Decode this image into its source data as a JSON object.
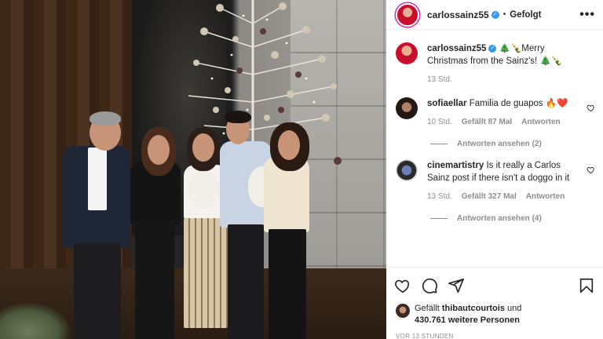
{
  "post": {
    "username": "carlossainz55",
    "follow_status": "Gefolgt",
    "more_label": "•••"
  },
  "caption": {
    "username": "carlossainz55",
    "emojis_before": "🎄🍾",
    "text": "Merry Christmas from the Sainz's!",
    "emojis_after": "🎄🍾",
    "time": "13 Std."
  },
  "comments": [
    {
      "username": "sofiaellar",
      "text": "Familia de guapos 🔥❤️",
      "time": "10 Std.",
      "likes": "Gefällt 87 Mal",
      "reply_label": "Antworten",
      "view_replies": "Antworten ansehen (2)"
    },
    {
      "username": "cinemartistry",
      "text": "Is it really a Carlos Sainz post if there isn't a doggo in it",
      "time": "13 Std.",
      "likes": "Gefällt 327 Mal",
      "reply_label": "Antworten",
      "view_replies": "Antworten ansehen (4)"
    }
  ],
  "likes": {
    "prefix": "Gefällt",
    "liked_by": "thibautcourtois",
    "connector": "und",
    "others": "430.761 weitere Personen"
  },
  "timestamp": "VOR 13 STUNDEN",
  "icons": {
    "like": "heart-icon",
    "comment": "comment-icon",
    "share": "share-icon",
    "save": "bookmark-icon",
    "verified": "verified-badge-icon",
    "more": "more-options-icon"
  },
  "colors": {
    "verified": "#3897f0",
    "muted": "#8e8e8e",
    "text": "#262626"
  }
}
